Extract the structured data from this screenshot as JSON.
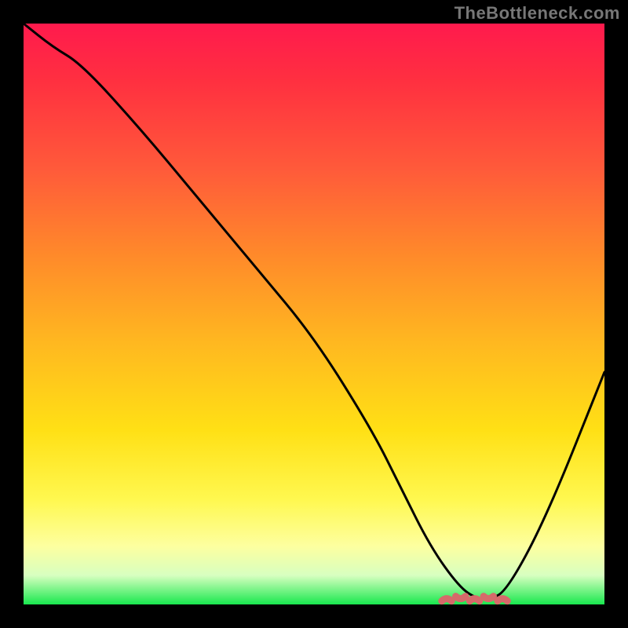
{
  "watermark": "TheBottleneck.com",
  "colors": {
    "background": "#000000",
    "gradient_top": "#ff1a4d",
    "gradient_bottom": "#19e84e",
    "curve": "#000000",
    "valley_accent": "#d66a6a"
  },
  "chart_data": {
    "type": "line",
    "title": "",
    "xlabel": "",
    "ylabel": "",
    "xlim": [
      0,
      100
    ],
    "ylim": [
      0,
      100
    ],
    "series": [
      {
        "name": "bottleneck-curve",
        "x": [
          0,
          5,
          10,
          20,
          30,
          40,
          50,
          60,
          65,
          70,
          75,
          78,
          80,
          83,
          90,
          100
        ],
        "values": [
          100,
          96,
          93,
          82,
          70,
          58,
          46,
          30,
          20,
          10,
          3,
          1,
          1,
          2,
          15,
          40
        ]
      }
    ],
    "annotations": [
      {
        "name": "valley-flat-segment",
        "x_start": 72,
        "x_end": 84,
        "y": 1
      }
    ]
  }
}
